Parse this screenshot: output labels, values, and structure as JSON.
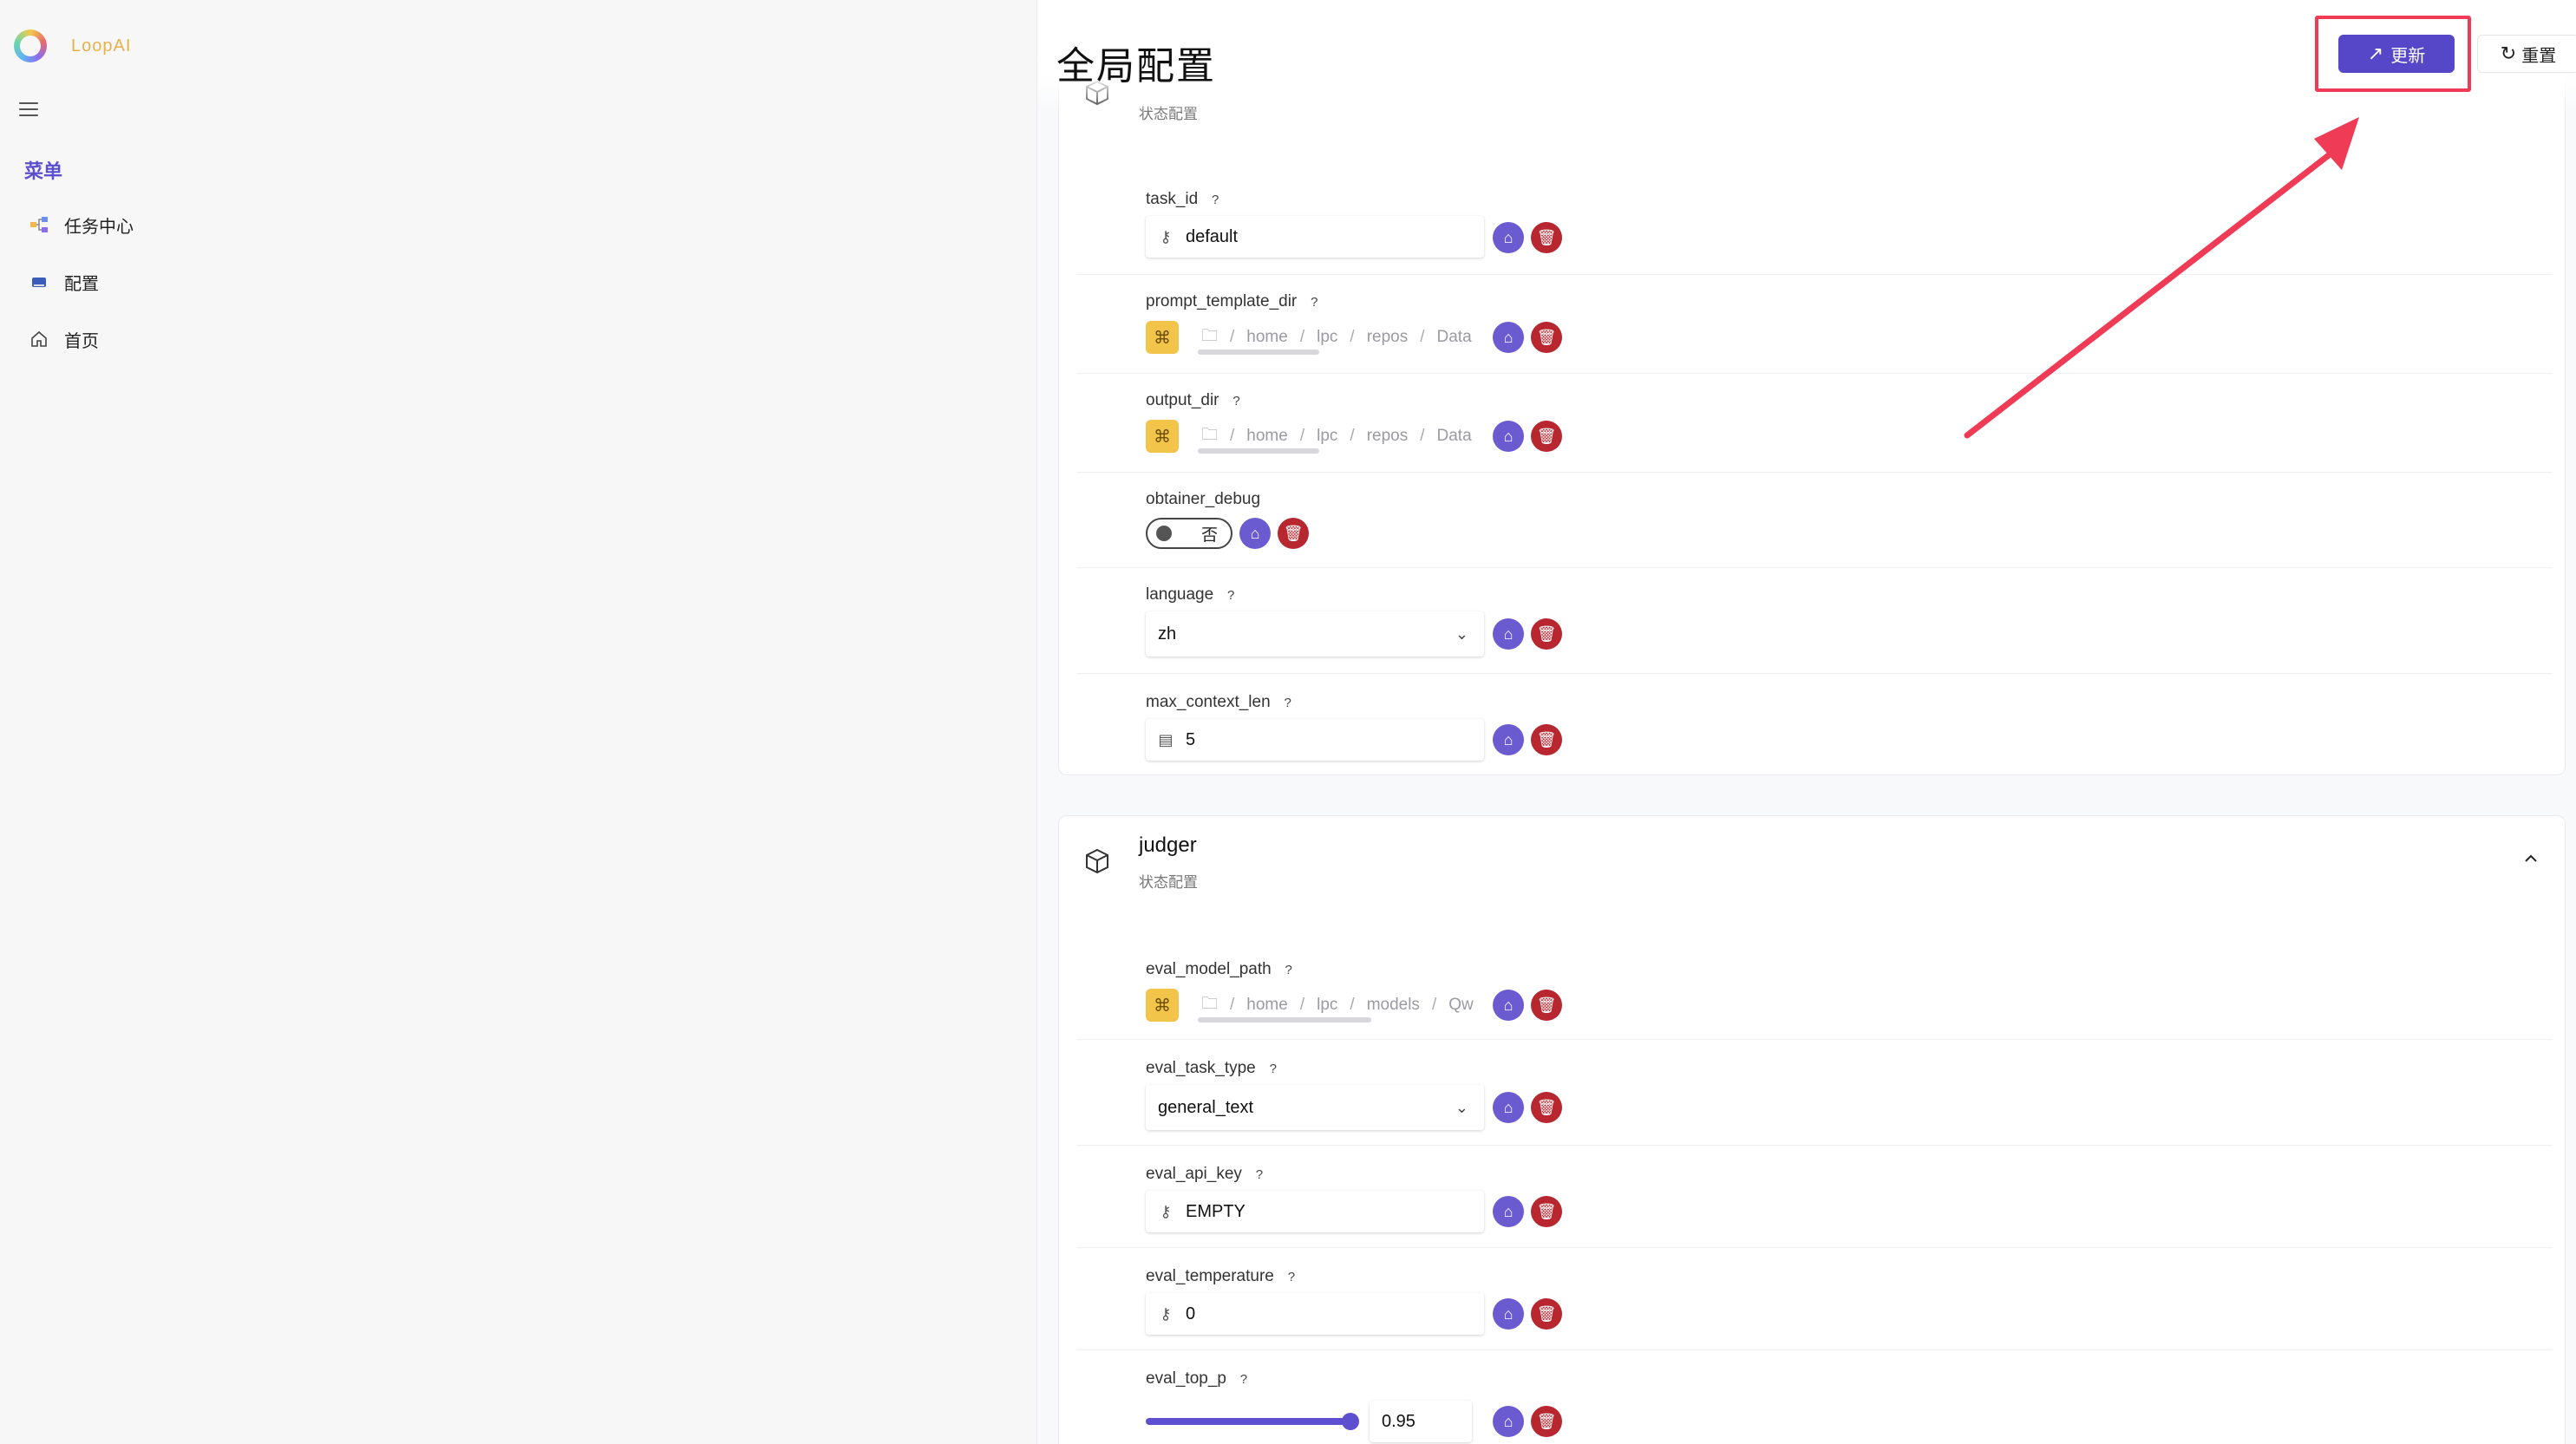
{
  "sidebar": {
    "logo_text": "LoopAI",
    "menu_title": "菜单",
    "items": [
      {
        "label": "任务中心"
      },
      {
        "label": "配置"
      },
      {
        "label": "首页"
      }
    ]
  },
  "header": {
    "title": "全局配置",
    "update_label": "更新",
    "reset_label": "重置"
  },
  "cards": [
    {
      "title": "",
      "subtitle": "状态配置",
      "fields": {
        "task_id": {
          "label": "task_id",
          "value": "default"
        },
        "prompt_template_dir": {
          "label": "prompt_template_dir",
          "crumbs": [
            "home",
            "lpc",
            "repos",
            "Data"
          ]
        },
        "output_dir": {
          "label": "output_dir",
          "crumbs": [
            "home",
            "lpc",
            "repos",
            "Data"
          ]
        },
        "obtainer_debug": {
          "label": "obtainer_debug",
          "value": "否"
        },
        "language": {
          "label": "language",
          "value": "zh"
        },
        "max_context_len": {
          "label": "max_context_len",
          "value": "5"
        }
      }
    },
    {
      "title": "judger",
      "subtitle": "状态配置",
      "fields": {
        "eval_model_path": {
          "label": "eval_model_path",
          "crumbs": [
            "home",
            "lpc",
            "models",
            "Qw"
          ]
        },
        "eval_task_type": {
          "label": "eval_task_type",
          "value": "general_text"
        },
        "eval_api_key": {
          "label": "eval_api_key",
          "value": "EMPTY"
        },
        "eval_temperature": {
          "label": "eval_temperature",
          "value": "0"
        },
        "eval_top_p": {
          "label": "eval_top_p",
          "value": "0.95",
          "slider_fraction": 1.0
        }
      }
    }
  ],
  "colors": {
    "accent": "#5547c8",
    "save_action": "#6a5bd0",
    "delete_action": "#b8262f",
    "path_button": "#f3c44a",
    "annotation": "#ef3b55"
  },
  "icons": {
    "save": "save-icon",
    "delete": "trash-icon",
    "key": "key-icon",
    "folder": "folder-icon",
    "number": "number-icon",
    "package": "package-icon"
  }
}
